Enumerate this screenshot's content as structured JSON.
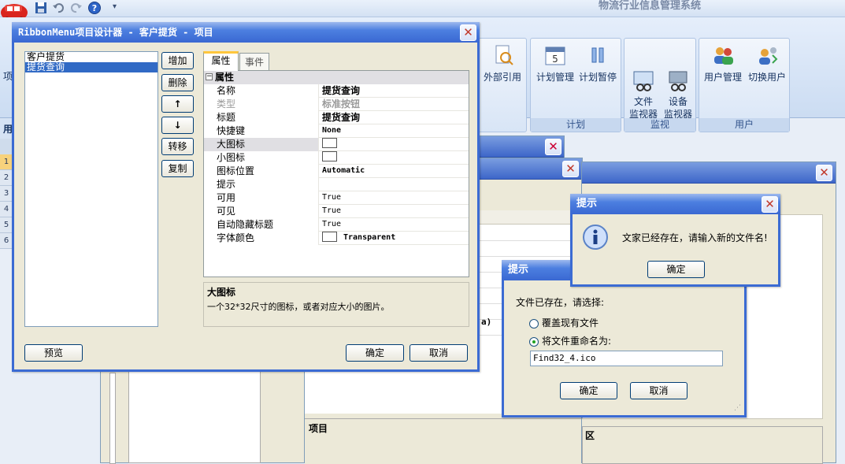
{
  "app": {
    "title": "物流行业信息管理系统"
  },
  "ribbon": {
    "left_cut_label": "项",
    "groups": [
      {
        "label": "",
        "buttons": [
          {
            "label": "外部引用",
            "icon": "external-reference-icon"
          }
        ]
      },
      {
        "label": "计划",
        "buttons": [
          {
            "label": "计划管理",
            "icon": "calendar-icon"
          },
          {
            "label": "计划暂停",
            "icon": "pause-icon"
          }
        ]
      },
      {
        "label": "监视",
        "buttons": [
          {
            "label": "文件\n监视器",
            "icon": "file-monitor-icon"
          },
          {
            "label": "设备\n监视器",
            "icon": "device-monitor-icon"
          }
        ]
      },
      {
        "label": "用户",
        "buttons": [
          {
            "label": "用户管理",
            "icon": "users-icon"
          },
          {
            "label": "切换用户",
            "icon": "switch-user-icon"
          }
        ]
      }
    ]
  },
  "left_tab_label": "用",
  "row_numbers": [
    "1",
    "2",
    "3",
    "4",
    "5",
    "6"
  ],
  "designer": {
    "title": "RibbonMenu项目设计器 - 客户提货 - 项目",
    "items": [
      "客户提货",
      "提货查询"
    ],
    "selected_index": 1,
    "side_buttons": {
      "add": "增加",
      "delete": "删除",
      "up": "↑",
      "down": "↓",
      "move": "转移",
      "copy": "复制"
    },
    "tabs": {
      "properties": "属性",
      "events": "事件"
    },
    "category": "属性",
    "properties": [
      {
        "name": "名称",
        "value": "提货查询",
        "style": "bold"
      },
      {
        "name": "类型",
        "value": "标准按钮",
        "style": "dim"
      },
      {
        "name": "标题",
        "value": "提货查询",
        "style": "bold"
      },
      {
        "name": "快捷键",
        "value": "None",
        "style": "mono"
      },
      {
        "name": "大图标",
        "value": "",
        "style": "swatch",
        "highlight": true
      },
      {
        "name": "小图标",
        "value": "",
        "style": "swatch"
      },
      {
        "name": "图标位置",
        "value": "Automatic",
        "style": "mono"
      },
      {
        "name": "提示",
        "value": "",
        "style": "mono"
      },
      {
        "name": "可用",
        "value": "True",
        "style": "mono"
      },
      {
        "name": "可见",
        "value": "True",
        "style": "mono"
      },
      {
        "name": "自动隐藏标题",
        "value": "True",
        "style": "mono"
      },
      {
        "name": "字体颜色",
        "value": "Transparent",
        "style": "swatch-text"
      }
    ],
    "description": {
      "title": "大图标",
      "text": "一个32*32尺寸的图标，或者对应大小的图片。"
    },
    "buttons": {
      "preview": "预览",
      "ok": "确定",
      "cancel": "取消"
    }
  },
  "background": {
    "row_label": "项目",
    "region_label": "区",
    "cut_text": "a)"
  },
  "prompt1": {
    "title": "提示",
    "message": "文家已经存在，请输入新的文件名!",
    "ok": "确定"
  },
  "prompt2": {
    "title": "提示",
    "message": "文件已存在，请选择:",
    "option_overwrite": "覆盖现有文件",
    "option_rename": "将文件重命名为:",
    "selected_option": "rename",
    "filename": "Find32_4.ico",
    "ok": "确定",
    "cancel": "取消"
  }
}
